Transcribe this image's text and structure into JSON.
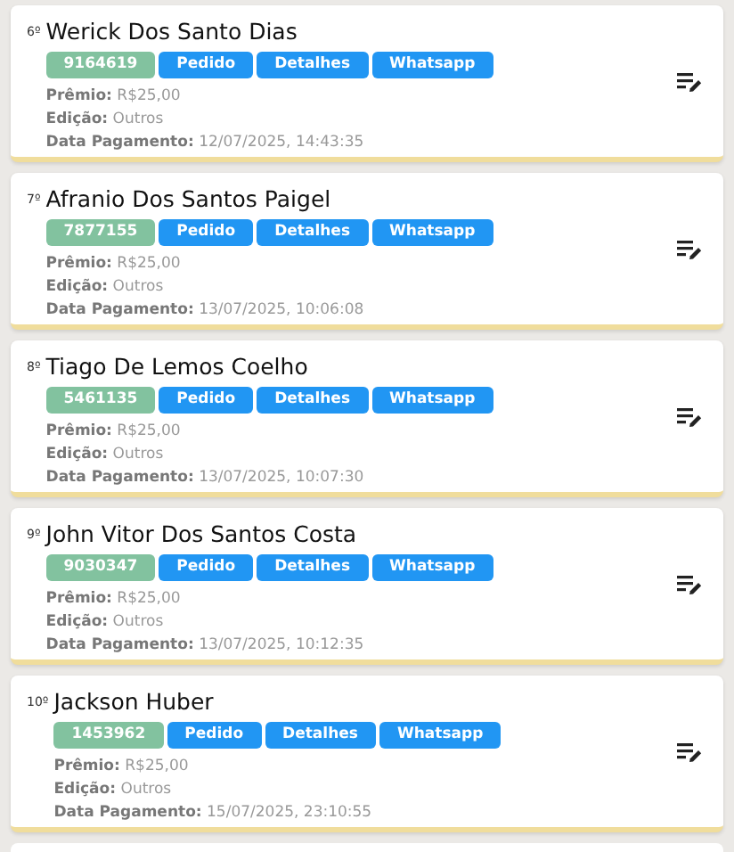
{
  "entries": [
    {
      "rank": "6º",
      "name": "Werick Dos Santo Dias",
      "code": "9164619",
      "buttons": [
        "Pedido",
        "Detalhes",
        "Whatsapp"
      ],
      "fields": [
        {
          "label": "Prêmio:",
          "value": "R$25,00"
        },
        {
          "label": "Edição:",
          "value": "Outros"
        },
        {
          "label": "Data Pagamento:",
          "value": "12/07/2025, 14:43:35"
        }
      ]
    },
    {
      "rank": "7º",
      "name": "Afranio Dos Santos Paigel",
      "code": "7877155",
      "buttons": [
        "Pedido",
        "Detalhes",
        "Whatsapp"
      ],
      "fields": [
        {
          "label": "Prêmio:",
          "value": "R$25,00"
        },
        {
          "label": "Edição:",
          "value": "Outros"
        },
        {
          "label": "Data Pagamento:",
          "value": "13/07/2025, 10:06:08"
        }
      ]
    },
    {
      "rank": "8º",
      "name": "Tiago De Lemos Coelho",
      "code": "5461135",
      "buttons": [
        "Pedido",
        "Detalhes",
        "Whatsapp"
      ],
      "fields": [
        {
          "label": "Prêmio:",
          "value": "R$25,00"
        },
        {
          "label": "Edição:",
          "value": "Outros"
        },
        {
          "label": "Data Pagamento:",
          "value": "13/07/2025, 10:07:30"
        }
      ]
    },
    {
      "rank": "9º",
      "name": "John Vitor Dos Santos Costa",
      "code": "9030347",
      "buttons": [
        "Pedido",
        "Detalhes",
        "Whatsapp"
      ],
      "fields": [
        {
          "label": "Prêmio:",
          "value": "R$25,00"
        },
        {
          "label": "Edição:",
          "value": "Outros"
        },
        {
          "label": "Data Pagamento:",
          "value": "13/07/2025, 10:12:35"
        }
      ]
    },
    {
      "rank": "10º",
      "name": "Jackson Huber",
      "code": "1453962",
      "buttons": [
        "Pedido",
        "Detalhes",
        "Whatsapp"
      ],
      "fields": [
        {
          "label": "Prêmio:",
          "value": "R$25,00"
        },
        {
          "label": "Edição:",
          "value": "Outros"
        },
        {
          "label": "Data Pagamento:",
          "value": "15/07/2025, 23:10:55"
        }
      ]
    }
  ]
}
